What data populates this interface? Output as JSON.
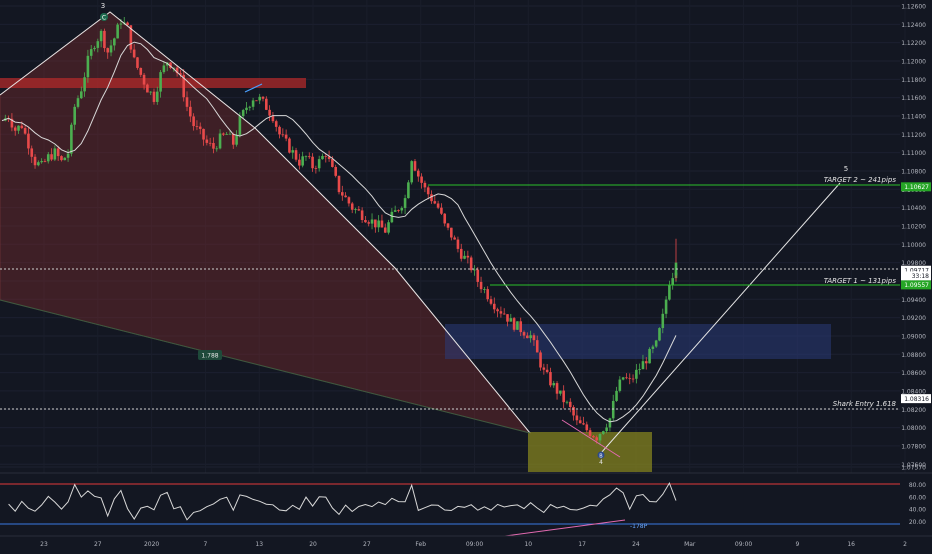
{
  "chart_data": {
    "type": "candlestick",
    "symbol": "EURUSD",
    "price_axis": {
      "ticks": [
        "1.12600",
        "1.12400",
        "1.12200",
        "1.12000",
        "1.11800",
        "1.11600",
        "1.11400",
        "1.11200",
        "1.11000",
        "1.10800",
        "1.10600",
        "1.10400",
        "1.10200",
        "1.10000",
        "1.09800",
        "1.09600",
        "1.09400",
        "1.09200",
        "1.09000",
        "1.08800",
        "1.08600",
        "1.08400",
        "1.08200",
        "1.08000",
        "1.07800",
        "1.07600",
        "1.07570"
      ],
      "range": [
        1.0757,
        1.127
      ]
    },
    "time_axis": {
      "ticks": [
        "23",
        "27",
        "2020",
        "7",
        "13",
        "20",
        "27",
        "Feb",
        "09:00",
        "10",
        "17",
        "24",
        "Mar",
        "09:00",
        "9",
        "16",
        "2"
      ]
    },
    "price_labels": [
      {
        "name": "target2",
        "text": "1.10627",
        "value": 1.10627,
        "color": "#26a626"
      },
      {
        "name": "current",
        "text": "1.09717",
        "value": 1.09717,
        "color": "#ffffff"
      },
      {
        "name": "countdown",
        "text": "33:18",
        "value": 1.09655,
        "color": "#ffffff"
      },
      {
        "name": "target1",
        "text": "1.09557",
        "value": 1.09557,
        "color": "#26a626"
      },
      {
        "name": "entry",
        "text": "1.08316",
        "value": 1.08316,
        "color": "#ffffff"
      }
    ],
    "annotations": {
      "target2": "TARGET 2 ~ 241pips",
      "target1": "TARGET 1 ~ 131pips",
      "entry": "Shark Entry 1.618",
      "fib": "1.788",
      "pt3": "3",
      "ptC": "C",
      "pt4": "4",
      "pt5": "5",
      "ptB": "B",
      "rsi_div": "-178P"
    },
    "rsi": {
      "levels": [
        70,
        30
      ],
      "ticks": [
        "80.00",
        "60.00",
        "40.00",
        "20.00"
      ]
    },
    "price_series": [
      1.1135,
      1.114,
      1.1125,
      1.113,
      1.111,
      1.109,
      1.1085,
      1.1095,
      1.11,
      1.109,
      1.11,
      1.115,
      1.117,
      1.12,
      1.122,
      1.123,
      1.121,
      1.1225,
      1.1245,
      1.1235,
      1.12,
      1.1185,
      1.117,
      1.116,
      1.1185,
      1.12,
      1.1195,
      1.118,
      1.115,
      1.113,
      1.112,
      1.111,
      1.1105,
      1.1115,
      1.112,
      1.111,
      1.1135,
      1.115,
      1.116,
      1.1158,
      1.115,
      1.114,
      1.112,
      1.111,
      1.11,
      1.109,
      1.1095,
      1.1085,
      1.109,
      1.11,
      1.108,
      1.106,
      1.105,
      1.104,
      1.1035,
      1.103,
      1.1025,
      1.102,
      1.1015,
      1.103,
      1.104,
      1.105,
      1.1095,
      1.1075,
      1.106,
      1.105,
      1.104,
      1.102,
      1.101,
      1.0995,
      1.0985,
      1.0975,
      1.096,
      1.095,
      1.094,
      1.093,
      1.0925,
      1.0915,
      1.091,
      1.0905,
      1.09,
      1.088,
      1.086,
      1.085,
      1.084,
      1.083,
      1.082,
      1.0805,
      1.08,
      1.0795,
      1.079,
      1.08,
      1.081,
      1.084,
      1.0855,
      1.085,
      1.086,
      1.087,
      1.088,
      1.089,
      1.092,
      1.096,
      1.0975
    ]
  }
}
